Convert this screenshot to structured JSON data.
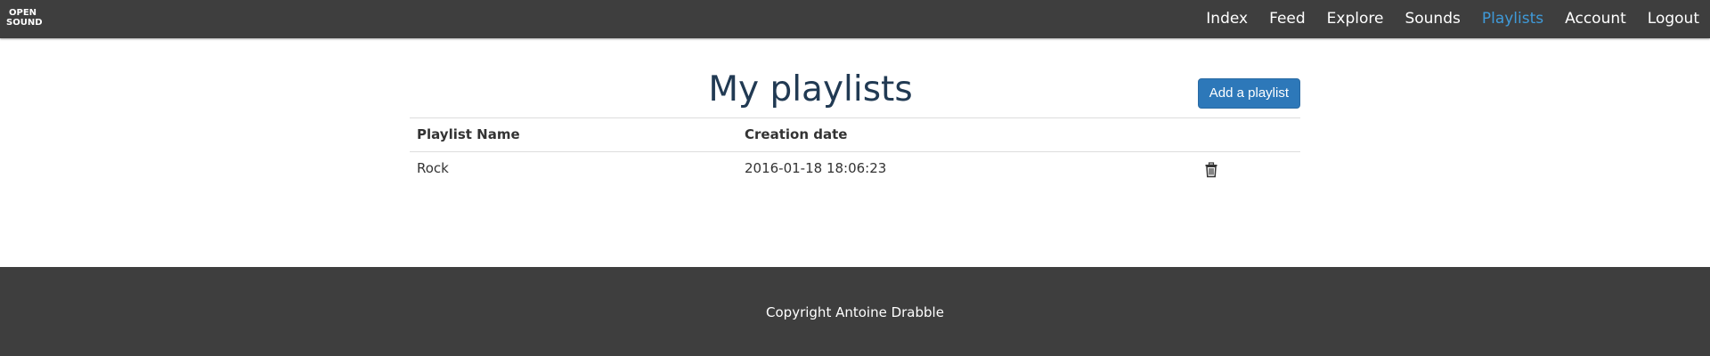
{
  "navbar": {
    "logo_line1": "OPEN",
    "logo_line2": "SOUND",
    "items": [
      {
        "label": "Index",
        "active": false
      },
      {
        "label": "Feed",
        "active": false
      },
      {
        "label": "Explore",
        "active": false
      },
      {
        "label": "Sounds",
        "active": false
      },
      {
        "label": "Playlists",
        "active": true
      },
      {
        "label": "Account",
        "active": false
      },
      {
        "label": "Logout",
        "active": false
      }
    ],
    "background_color": "#3e3e3e",
    "active_color": "#3f9ad9"
  },
  "main": {
    "title": "My playlists",
    "add_button_label": "Add a playlist",
    "table": {
      "headers": [
        "Playlist Name",
        "Creation date",
        ""
      ],
      "rows": [
        {
          "name": "Rock",
          "created": "2016-01-18 18:06:23",
          "action_icon": "trash-icon"
        }
      ]
    }
  },
  "footer": {
    "copyright": "Copyright Antoine Drabble"
  }
}
